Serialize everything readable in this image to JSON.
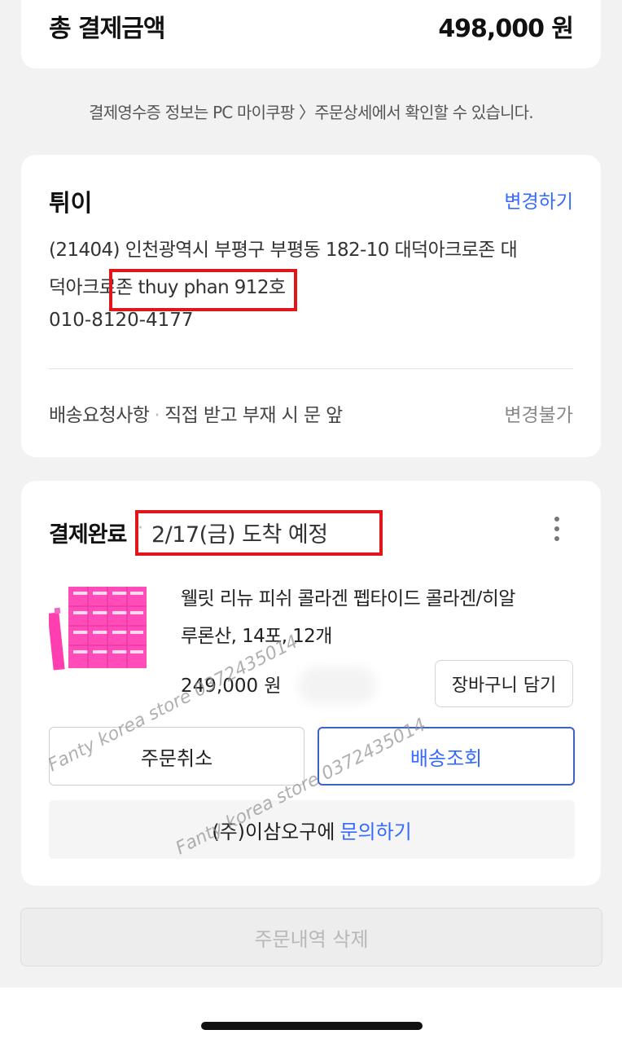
{
  "payment": {
    "total_label": "총 결제금액",
    "total_value": "498,000 원"
  },
  "notice": "결제영수증 정보는 PC 마이쿠팡 〉주문상세에서 확인할 수 있습니다.",
  "address": {
    "name": "튀이",
    "change_label": "변경하기",
    "line1": "(21404) 인천광역시 부평구 부평동 182-10 대덕아크로존 대",
    "line2": "덕아크로존 thuy phan 912호",
    "phone": "010-8120-4177",
    "request_label": "배송요청사항",
    "request_value": "직접 받고 부재 시 문 앞",
    "request_status": "변경불가"
  },
  "order": {
    "status": "결제완료",
    "arrival": "2/17(금) 도착 예정",
    "product_name_line1": "웰릿 리뉴 피쉬 콜라겐 펩타이드 콜라겐/히알",
    "product_name_line2": "루론산, 14포, 12개",
    "price": "249,000 원",
    "cart_button": "장바구니 담기",
    "cancel_button": "주문취소",
    "track_button": "배송조회",
    "inquiry_prefix": "(주)이삼오구에",
    "inquiry_link": "문의하기"
  },
  "delete_button": "주문내역 삭제",
  "watermark": {
    "text_a": "Fanty korea store 0372435014",
    "text_b": "Fanty korea store 0372435014"
  },
  "colors": {
    "accent": "#346aff",
    "highlight": "#e0161b",
    "product_pink": "#ff3fb0"
  }
}
